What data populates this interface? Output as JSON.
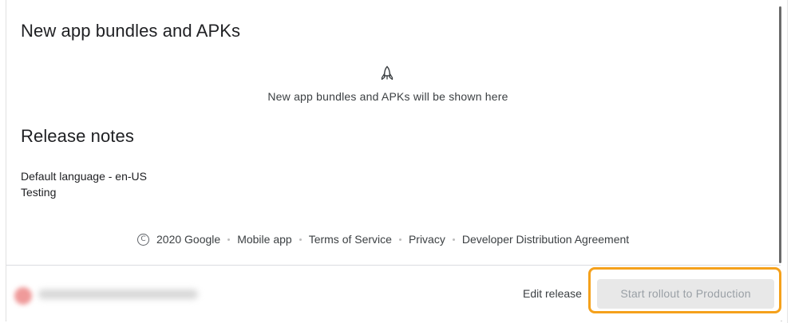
{
  "bundles_section": {
    "title": "New app bundles and APKs",
    "empty_icon": "rocket-outline-icon",
    "empty_message": "New app bundles and APKs will be shown here"
  },
  "release_notes": {
    "title": "Release notes",
    "language": "Default language - en-US",
    "text": "Testing"
  },
  "footer": {
    "copyright_icon": "copyright-icon",
    "copyright": "2020 Google",
    "links": [
      "Mobile app",
      "Terms of Service",
      "Privacy",
      "Developer Distribution Agreement"
    ]
  },
  "bottom_bar": {
    "edit_release_label": "Edit release",
    "start_rollout_label": "Start rollout to Production",
    "start_rollout_enabled": false,
    "highlight_color": "#f5a11c"
  }
}
